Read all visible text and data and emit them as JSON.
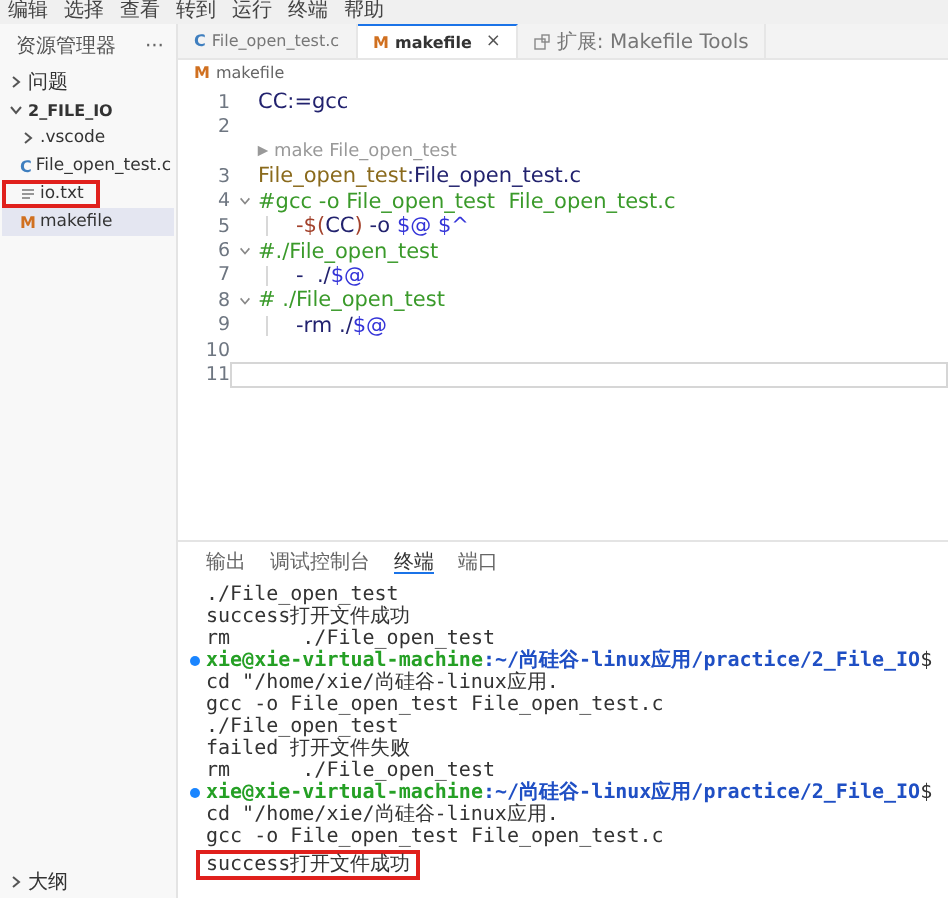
{
  "menu_bar": [
    "编辑",
    "选择",
    "查看",
    "转到",
    "运行",
    "终端",
    "帮助"
  ],
  "sidebar": {
    "title": "资源管理器",
    "more": "···",
    "items": [
      {
        "label": "问题",
        "kind": "section",
        "expanded": false,
        "selected": false,
        "highlighted": false
      },
      {
        "label": "2_FILE_IO",
        "kind": "folder",
        "expanded": true,
        "selected": false,
        "highlighted": false,
        "children": [
          {
            "label": ".vscode",
            "kind": "folder",
            "expanded": false,
            "selected": false,
            "highlighted": false
          },
          {
            "label": "File_open_test.c",
            "kind": "c-file",
            "icon": "C",
            "selected": false,
            "highlighted": false
          },
          {
            "label": "io.txt",
            "kind": "text-file",
            "selected": false,
            "highlighted": true
          },
          {
            "label": "makefile",
            "kind": "makefile",
            "icon": "M",
            "selected": true,
            "highlighted": false
          }
        ]
      }
    ],
    "outline": {
      "label": "大纲",
      "expanded": false
    }
  },
  "tabs": [
    {
      "label": "File_open_test.c",
      "kind": "c-file",
      "icon": "C",
      "selected": false
    },
    {
      "label": "makefile",
      "kind": "makefile",
      "icon": "M",
      "selected": true,
      "close": "×"
    },
    {
      "label": "扩展: Makefile Tools",
      "kind": "extension",
      "selected": false
    }
  ],
  "breadcrumb": {
    "icon": "M",
    "label": "makefile"
  },
  "code_lines": [
    {
      "kind": "code",
      "number": "1",
      "foldable": false,
      "indented": false,
      "current": false,
      "segments": [
        {
          "text": "CC:=gcc",
          "kind": "plain"
        }
      ]
    },
    {
      "kind": "code",
      "number": "2"
    },
    {
      "kind": "codelens",
      "text": "make File_open_test"
    },
    {
      "kind": "code",
      "number": "3",
      "foldable": false,
      "indented": false,
      "current": false,
      "segments": [
        {
          "text": "File_open_test",
          "kind": "target"
        },
        {
          "text": ":File_open_test.c",
          "kind": "plain"
        }
      ]
    },
    {
      "kind": "code",
      "number": "4",
      "foldable": true,
      "indented": false,
      "current": false,
      "segments": [
        {
          "text": "#gcc -o File_open_test  File_open_test.c",
          "kind": "comment"
        }
      ]
    },
    {
      "kind": "code",
      "number": "5",
      "foldable": false,
      "indented": true,
      "current": false,
      "segments": [
        {
          "text": "-$(",
          "kind": "operator"
        },
        {
          "text": "CC",
          "kind": "plain"
        },
        {
          "text": ")",
          "kind": "operator"
        },
        {
          "text": " -o ",
          "kind": "plain"
        },
        {
          "text": "$@ $^",
          "kind": "variable"
        }
      ]
    },
    {
      "kind": "code",
      "number": "6",
      "foldable": true,
      "indented": false,
      "current": false,
      "segments": [
        {
          "text": "#./File_open_test",
          "kind": "comment"
        }
      ]
    },
    {
      "kind": "code",
      "number": "7",
      "foldable": false,
      "indented": true,
      "current": false,
      "segments": [
        {
          "text": "-  ./",
          "kind": "plain"
        },
        {
          "text": "$@",
          "kind": "variable"
        }
      ]
    },
    {
      "kind": "code",
      "number": "8",
      "foldable": true,
      "indented": false,
      "current": false,
      "segments": [
        {
          "text": "# ./File_open_test",
          "kind": "comment"
        }
      ]
    },
    {
      "kind": "code",
      "number": "9",
      "foldable": false,
      "indented": true,
      "current": false,
      "segments": [
        {
          "text": "-rm ./",
          "kind": "plain"
        },
        {
          "text": "$@",
          "kind": "variable"
        }
      ]
    },
    {
      "kind": "code",
      "number": "10"
    },
    {
      "kind": "code",
      "number": "11",
      "foldable": false,
      "indented": false,
      "current": true
    }
  ],
  "panel": {
    "tabs": [
      {
        "label": "输出",
        "selected": false
      },
      {
        "label": "调试控制台",
        "selected": false
      },
      {
        "label": "终端",
        "selected": true
      },
      {
        "label": "端口",
        "selected": false
      }
    ],
    "terminal_lines": [
      {
        "kind": "output",
        "text": "./File_open_test",
        "highlighted": false
      },
      {
        "kind": "output",
        "text": "success打开文件成功",
        "highlighted": false
      },
      {
        "kind": "output",
        "text": "rm      ./File_open_test",
        "highlighted": false
      },
      {
        "kind": "prompt",
        "user": "xie@xie-virtual-machine",
        "path": ":~/尚硅谷-linux应用/practice/2_File_IO",
        "command": "$ cd \"/home/xie/尚硅谷-linux应用.",
        "highlighted": false
      },
      {
        "kind": "output",
        "text": "gcc -o File_open_test File_open_test.c",
        "highlighted": false
      },
      {
        "kind": "output",
        "text": "./File_open_test",
        "highlighted": false
      },
      {
        "kind": "output",
        "text": "failed 打开文件失败",
        "highlighted": false
      },
      {
        "kind": "output",
        "text": "rm      ./File_open_test",
        "highlighted": false
      },
      {
        "kind": "prompt",
        "user": "xie@xie-virtual-machine",
        "path": ":~/尚硅谷-linux应用/practice/2_File_IO",
        "command": "$ cd \"/home/xie/尚硅谷-linux应用.",
        "highlighted": false
      },
      {
        "kind": "output",
        "text": "gcc -o File_open_test File_open_test.c",
        "highlighted": false
      },
      {
        "kind": "output",
        "text": "success打开文件成功",
        "highlighted": true
      }
    ]
  }
}
